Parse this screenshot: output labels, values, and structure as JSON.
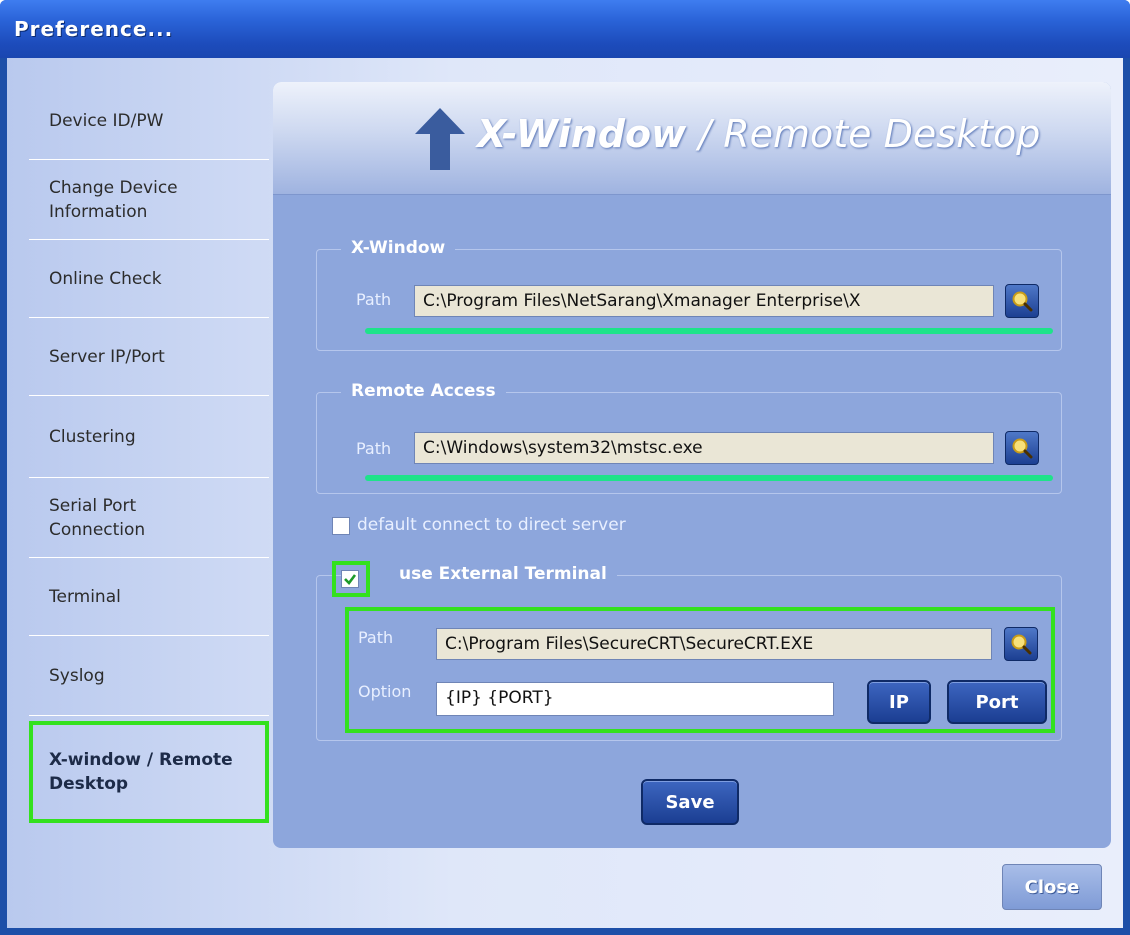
{
  "window": {
    "title": "Preference..."
  },
  "sidebar": {
    "items": [
      {
        "label": "Device ID/PW"
      },
      {
        "label": "Change Device Information"
      },
      {
        "label": "Online Check"
      },
      {
        "label": "Server IP/Port"
      },
      {
        "label": "Clustering"
      },
      {
        "label": "Serial Port Connection"
      },
      {
        "label": "Terminal"
      },
      {
        "label": "Syslog"
      },
      {
        "label": "X-window / Remote Desktop",
        "active": true
      }
    ]
  },
  "header": {
    "title_bold": "X-Window",
    "title_rest": " / Remote Desktop"
  },
  "xwindow": {
    "legend": "X-Window",
    "path_label": "Path",
    "path_value": "C:\\Program Files\\NetSarang\\Xmanager Enterprise\\X"
  },
  "remote": {
    "legend": "Remote Access",
    "path_label": "Path",
    "path_value": "C:\\Windows\\system32\\mstsc.exe"
  },
  "direct_server": {
    "label": "default connect to direct server",
    "checked": false
  },
  "external": {
    "label": "use External Terminal",
    "checked": true,
    "path_label": "Path",
    "path_value": "C:\\Program Files\\SecureCRT\\SecureCRT.EXE",
    "option_label": "Option",
    "option_value": "{IP}  {PORT}",
    "ip_button": "IP",
    "port_button": "Port"
  },
  "actions": {
    "save": "Save",
    "close": "Close"
  },
  "colors": {
    "highlight": "#33e11e",
    "underline": "#1ee38a",
    "panel": "#8da6dc",
    "title_bar": "#2a63d8"
  }
}
